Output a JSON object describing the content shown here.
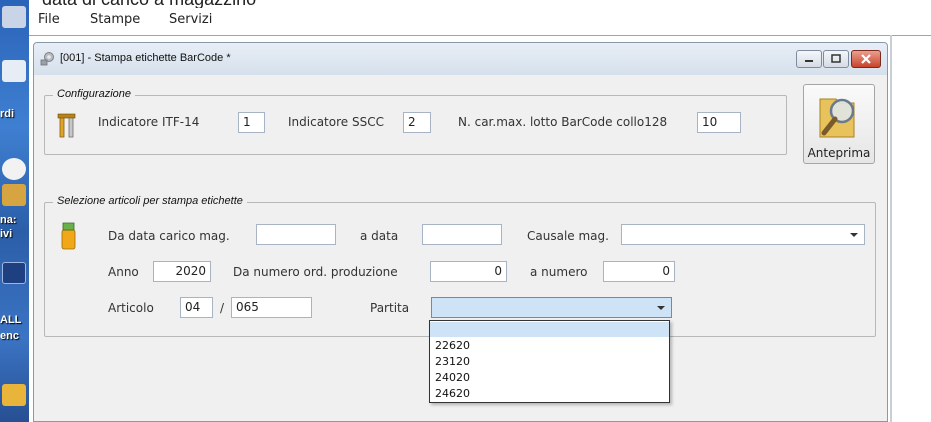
{
  "caption": {
    "text": "data di carico a magazzino"
  },
  "desktop": {
    "labels": [
      "rdi",
      "na:",
      "ivi",
      "ALL",
      "enc"
    ]
  },
  "menubar": {
    "items": [
      {
        "label": "File"
      },
      {
        "label": "Stampe"
      },
      {
        "label": "Servizi"
      }
    ]
  },
  "window": {
    "title": "[001] - Stampa etichette BarCode *",
    "buttons": [
      "minimize",
      "maximize",
      "close"
    ]
  },
  "configurazione": {
    "legend": "Configurazione",
    "itf14_label": "Indicatore ITF-14",
    "itf14_value": "1",
    "sscc_label": "Indicatore SSCC",
    "sscc_value": "2",
    "maxlen_label": "N. car.max. lotto BarCode collo128",
    "maxlen_value": "10"
  },
  "preview_button": {
    "label": "Anteprima"
  },
  "selezione": {
    "legend": "Selezione articoli per stampa etichette",
    "da_data_label": "Da data carico mag.",
    "da_data_value": "",
    "a_data_label": "a data",
    "a_data_value": "",
    "causale_label": "Causale mag.",
    "causale_value": "",
    "anno_label": "Anno",
    "anno_value": "2020",
    "da_numero_label": "Da numero ord. produzione",
    "da_numero_value": "0",
    "a_numero_label": "a numero",
    "a_numero_value": "0",
    "articolo_label": "Articolo",
    "articolo_part1": "04",
    "articolo_sep": "/",
    "articolo_part2": "065",
    "partita_label": "Partita",
    "partita_value": ""
  },
  "partita_dropdown": {
    "options": [
      "",
      "22620",
      "23120",
      "24020",
      "24620"
    ],
    "selected_index": 0
  },
  "colors": {
    "accent": "#3399ff",
    "selected_option": "#cfe3f7",
    "window_bg": "#f0f0f0",
    "close_button": "#c8442c"
  }
}
